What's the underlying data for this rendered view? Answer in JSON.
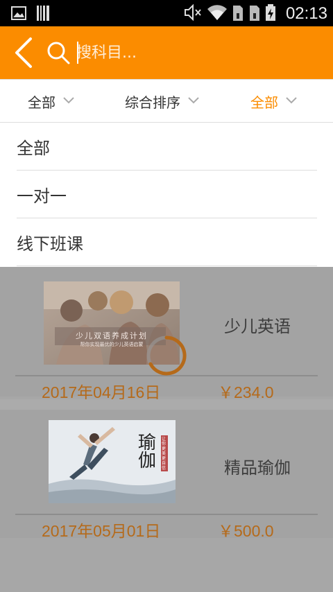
{
  "status_bar": {
    "time": "02:13",
    "left_icons": [
      "image-icon",
      "barcode-icon"
    ],
    "right_icons": [
      "mute-icon",
      "wifi-icon",
      "sim1-icon",
      "sim2-icon",
      "battery-charging-icon"
    ]
  },
  "header": {
    "background": "#fb8c00",
    "search_placeholder": "搜科目..."
  },
  "filters": [
    {
      "label": "全部",
      "active": false
    },
    {
      "label": "综合排序",
      "active": false
    },
    {
      "label": "全部",
      "active": true
    }
  ],
  "dropdown": {
    "items": [
      "全部",
      "一对一",
      "线下班课"
    ]
  },
  "courses": [
    {
      "title": "少儿英语",
      "banner_title": "少儿双语养成计划",
      "banner_subtitle": "帮你实现最优的少儿英语启蒙",
      "date": "2017年04月16日",
      "price": "￥234.0"
    },
    {
      "title": "精品瑜伽",
      "banner_title": "瑜伽",
      "banner_subtitle": "让你更美更自信",
      "date": "2017年05月01日",
      "price": "￥500.0"
    }
  ],
  "accent_color": "#fb8c00"
}
